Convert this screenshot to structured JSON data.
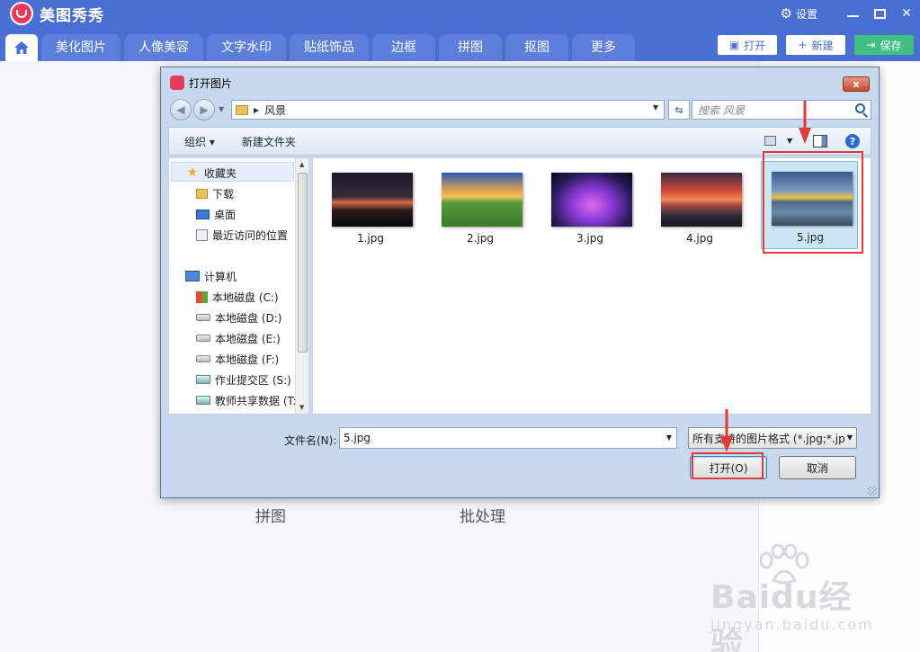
{
  "app": {
    "name": "美图秀秀",
    "settings_label": "设置"
  },
  "nav": {
    "tabs": [
      "美化图片",
      "人像美容",
      "文字水印",
      "贴纸饰品",
      "边框",
      "拼图",
      "抠图",
      "更多"
    ],
    "open_label": "打开",
    "new_label": "新建",
    "save_label": "保存"
  },
  "main": {
    "label_puzzle": "拼图",
    "label_batch": "批处理"
  },
  "watermark": {
    "brand": "Baidu经验",
    "url": "jingyan.baidu.com"
  },
  "dialog": {
    "title": "打开图片",
    "close_label": "x",
    "address": "风景",
    "search_placeholder": "搜索 风景",
    "toolbar_organize": "组织 ▾",
    "toolbar_new_folder": "新建文件夹",
    "nav_tree": {
      "favorites": "收藏夹",
      "downloads": "下载",
      "desktop": "桌面",
      "recent": "最近访问的位置",
      "computer": "计算机",
      "drive_c": "本地磁盘 (C:)",
      "drive_d": "本地磁盘 (D:)",
      "drive_e": "本地磁盘 (E:)",
      "drive_f": "本地磁盘 (F:)",
      "net_s": "作业提交区 (S:)",
      "net_t": "教师共享数据 (T:"
    },
    "files": [
      "1.jpg",
      "2.jpg",
      "3.jpg",
      "4.jpg",
      "5.jpg"
    ],
    "selected_file": "5.jpg",
    "filename_label": "文件名(N):",
    "filename_value": "5.jpg",
    "filter_value": "所有支持的图片格式 (*.jpg;*.jp",
    "open_button": "打开(O)",
    "cancel_button": "取消"
  },
  "colors": {
    "brand_blue": "#4a6fd4",
    "save_green": "#3fbf80",
    "highlight_red": "#e23a3a",
    "logo_pink": "#e83a5a"
  }
}
